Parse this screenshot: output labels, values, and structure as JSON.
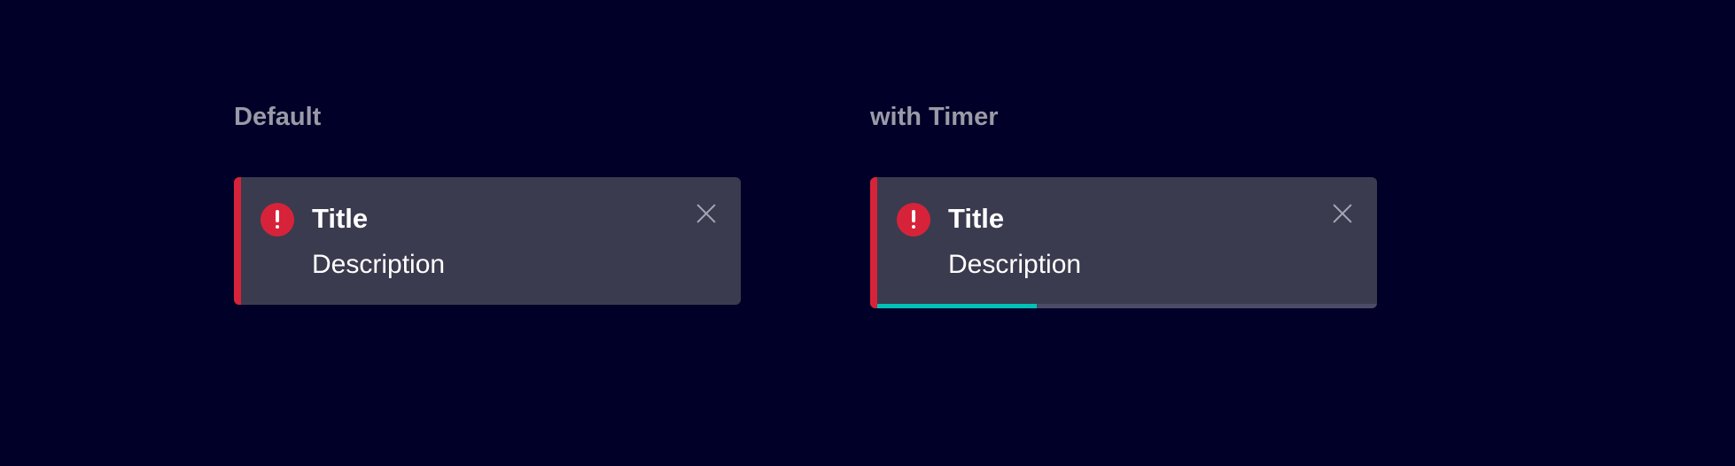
{
  "sections": {
    "default": {
      "label": "Default",
      "toast": {
        "title": "Title",
        "description": "Description",
        "icon": "alert-circle-icon",
        "close_icon": "close-icon"
      }
    },
    "timer": {
      "label": "with Timer",
      "toast": {
        "title": "Title",
        "description": "Description",
        "icon": "alert-circle-icon",
        "close_icon": "close-icon",
        "timer_progress": 0.32
      }
    }
  },
  "colors": {
    "background": "#000028",
    "toast_background": "#3b3b4f",
    "danger_accent": "#d72339",
    "timer_fill": "#00c1b6",
    "timer_track": "#4c4c68",
    "section_label": "#9a9aa8"
  }
}
